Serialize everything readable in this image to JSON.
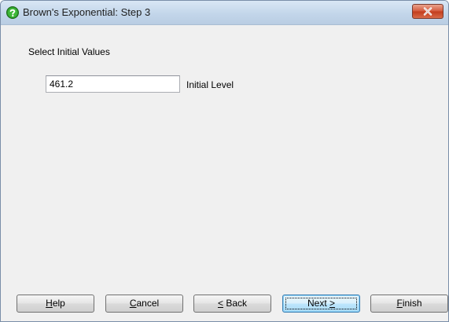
{
  "window": {
    "title": "Brown's Exponential: Step 3",
    "accent": "#c23c1c"
  },
  "content": {
    "section_label": "Select Initial Values",
    "initial_level": {
      "value": "461.2",
      "label": "Initial Level"
    }
  },
  "buttons": {
    "help": {
      "mnemonic": "H",
      "rest": "elp"
    },
    "cancel": {
      "mnemonic": "C",
      "rest": "ancel"
    },
    "back": {
      "mnemonic": "<",
      "rest": " Back"
    },
    "next": {
      "text": "Next ",
      "mnemonic": ">"
    },
    "finish": {
      "mnemonic": "F",
      "rest": "inish"
    }
  },
  "icons": {
    "title": "help-question-icon",
    "close": "close-icon"
  }
}
